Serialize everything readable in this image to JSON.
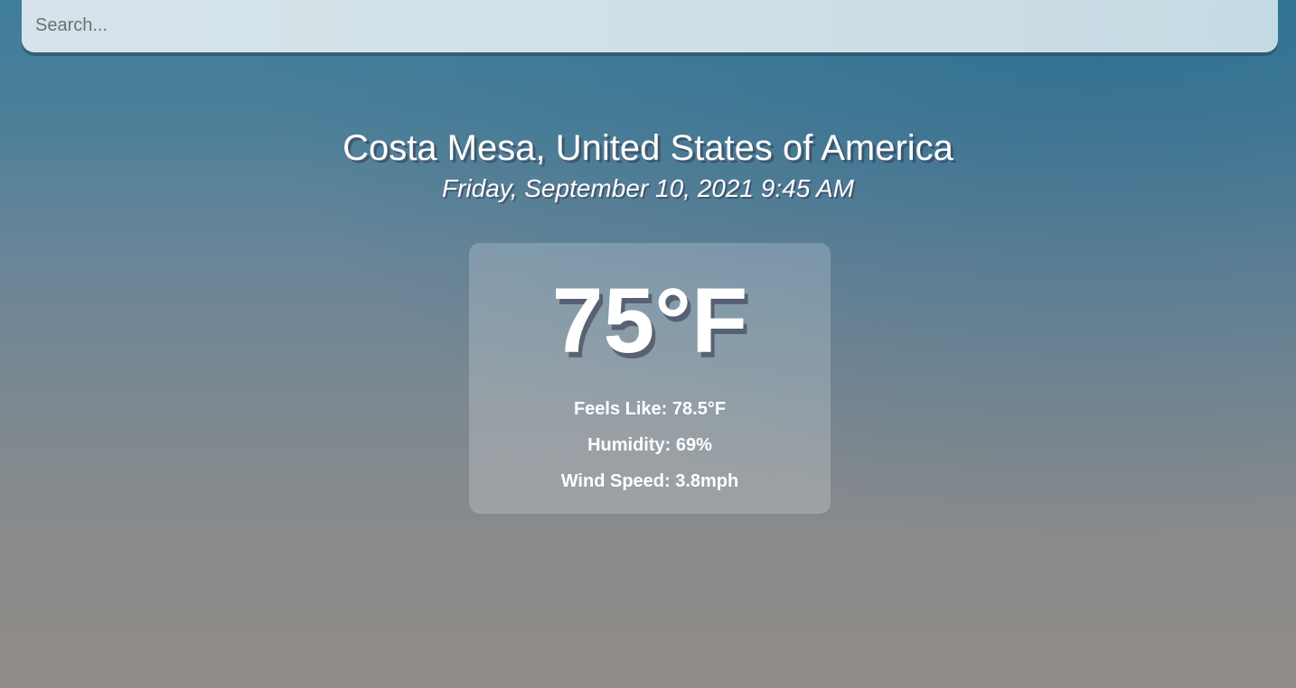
{
  "search": {
    "placeholder": "Search...",
    "value": ""
  },
  "location": {
    "name": "Costa Mesa, United States of America",
    "datetime": "Friday, September 10, 2021 9:45 AM"
  },
  "weather": {
    "temperature": "75°F",
    "feels_like": "Feels Like: 78.5°F",
    "humidity": "Humidity: 69%",
    "wind_speed": "Wind Speed: 3.8mph"
  },
  "colors": {
    "background_top": "#3f7e9c",
    "background_bottom": "#908c87",
    "text": "#ffffff"
  }
}
